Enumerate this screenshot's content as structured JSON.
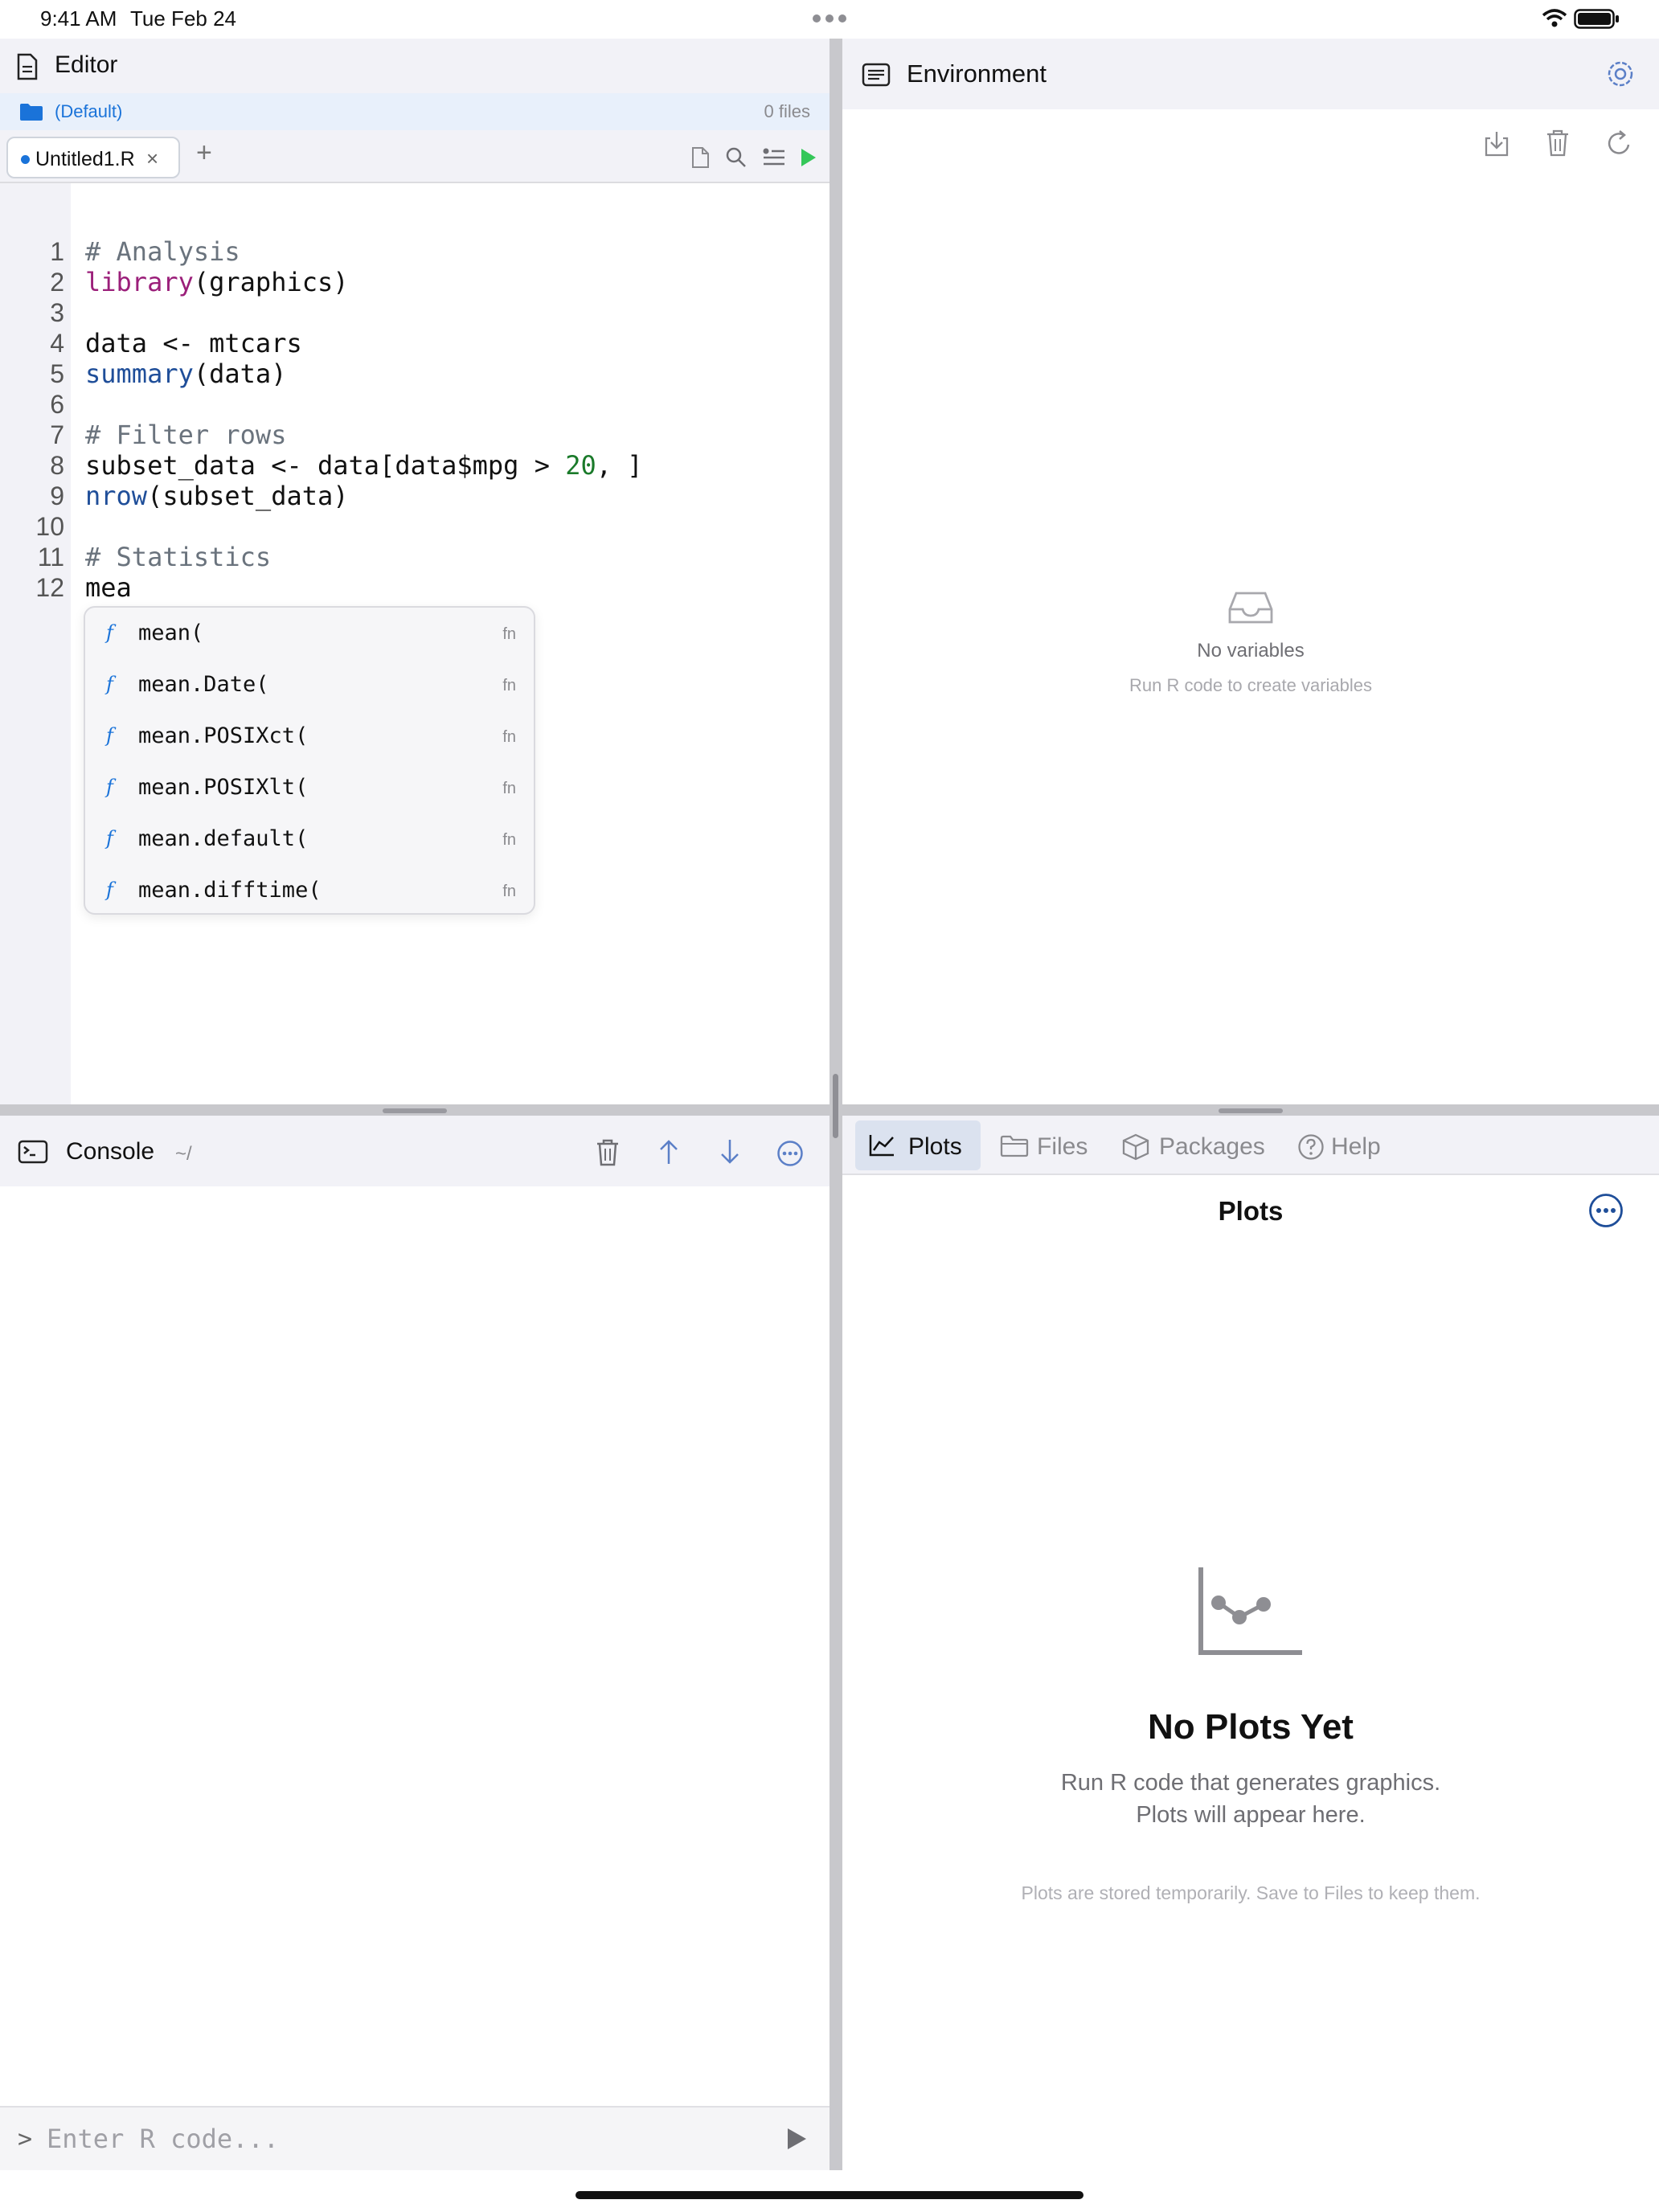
{
  "status_bar": {
    "time": "9:41 AM",
    "date": "Tue Feb 24"
  },
  "editor": {
    "title": "Editor",
    "project": {
      "name": "(Default)",
      "file_count": "0 files"
    },
    "tabs": [
      {
        "label": "Untitled1.R",
        "close": "×"
      }
    ],
    "add_tab": "+",
    "line_numbers": [
      "1",
      "2",
      "3",
      "4",
      "5",
      "6",
      "7",
      "8",
      "9",
      "10",
      "11",
      "12"
    ],
    "code": {
      "l1": "# Analysis",
      "l2_kw": "library",
      "l2_rest": "(graphics)",
      "l4": "data <- mtcars",
      "l5_fn": "summary",
      "l5_rest": "(data)",
      "l7": "# Filter rows",
      "l8_a": "subset_data <- data[data$mpg > ",
      "l8_num": "20",
      "l8_b": ", ]",
      "l9_fn": "nrow",
      "l9_rest": "(subset_data)",
      "l11": "# Statistics",
      "l12": "mea"
    },
    "autocomplete": [
      {
        "icon": "f",
        "label": "mean(",
        "kind": "fn"
      },
      {
        "icon": "f",
        "label": "mean.Date(",
        "kind": "fn"
      },
      {
        "icon": "f",
        "label": "mean.POSIXct(",
        "kind": "fn"
      },
      {
        "icon": "f",
        "label": "mean.POSIXlt(",
        "kind": "fn"
      },
      {
        "icon": "f",
        "label": "mean.default(",
        "kind": "fn"
      },
      {
        "icon": "f",
        "label": "mean.difftime(",
        "kind": "fn"
      }
    ]
  },
  "console": {
    "title": "Console",
    "path": "~/",
    "prompt": ">",
    "input_placeholder": "Enter R code..."
  },
  "environment": {
    "title": "Environment",
    "empty_title": "No variables",
    "empty_subtitle": "Run R code to create variables"
  },
  "pane_tabs": {
    "plots": "Plots",
    "files": "Files",
    "packages": "Packages",
    "help": "Help"
  },
  "plots": {
    "title": "Plots",
    "empty_title": "No Plots Yet",
    "empty_line1": "Run R code that generates graphics.",
    "empty_line2": "Plots will appear here.",
    "empty_note": "Plots are stored temporarily. Save to Files to keep them."
  },
  "colors": {
    "accent": "#1a73d9",
    "run_green": "#34c759",
    "panel_bg": "#f2f2f7"
  },
  "icons": [
    "document-icon",
    "folder-icon",
    "new-file-icon",
    "search-icon",
    "outline-icon",
    "run-icon",
    "terminal-icon",
    "trash-icon",
    "arrow-up-icon",
    "arrow-down-icon",
    "more-icon",
    "list-icon",
    "settings-icon",
    "import-icon",
    "refresh-icon",
    "inbox-icon",
    "chart-icon",
    "folder-icon",
    "package-icon",
    "help-icon",
    "play-icon"
  ]
}
